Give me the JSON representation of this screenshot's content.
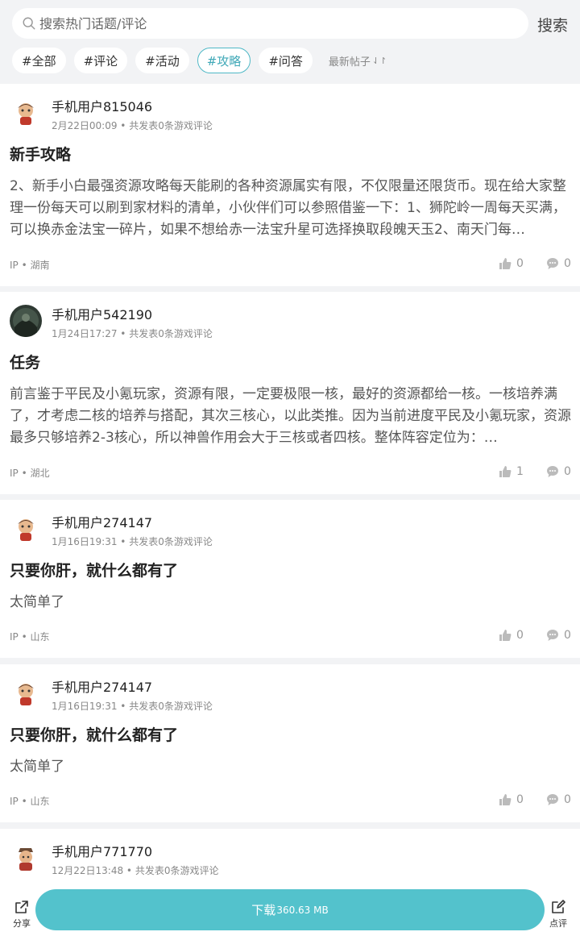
{
  "search": {
    "placeholder": "搜索热门话题/评论",
    "button": "搜索"
  },
  "tags": [
    "#全部",
    "#评论",
    "#活动",
    "#攻略",
    "#问答"
  ],
  "active_tag": "#攻略",
  "sort": {
    "label": "最新帖子",
    "icon": "sort-arrows-icon"
  },
  "posts": [
    {
      "user": "手机用户815046",
      "meta": "2月22日00:09 • 共发表0条游戏评论",
      "title": "新手攻略",
      "body": "2、新手小白最强资源攻略每天能刷的各种资源属实有限，不仅限量还限货币。现在给大家整理一份每天可以刷到家材料的清单，小伙伴们可以参照借鉴一下：1、狮陀岭一周每天买满，可以换赤金法宝一碎片，如果不想给赤一法宝升星可选择换取段魄天玉2、南天门每…",
      "ip": "IP • 湖南",
      "likes": "0",
      "comments": "0"
    },
    {
      "user": "手机用户542190",
      "meta": "1月24日17:27 • 共发表0条游戏评论",
      "title": "任务",
      "body": "前言鉴于平民及小氪玩家，资源有限，一定要极限一核，最好的资源都给一核。一核培养满了，才考虑二核的培养与搭配，其次三核心，以此类推。因为当前进度平民及小氪玩家，资源最多只够培养2-3核心，所以神兽作用会大于三核或者四核。整体阵容定位为：…",
      "ip": "IP • 湖北",
      "likes": "1",
      "comments": "0"
    },
    {
      "user": "手机用户274147",
      "meta": "1月16日19:31 • 共发表0条游戏评论",
      "title": "只要你肝，就什么都有了",
      "body": "太简单了",
      "ip": "IP • 山东",
      "likes": "0",
      "comments": "0"
    },
    {
      "user": "手机用户274147",
      "meta": "1月16日19:31 • 共发表0条游戏评论",
      "title": "只要你肝，就什么都有了",
      "body": "太简单了",
      "ip": "IP • 山东",
      "likes": "0",
      "comments": "0"
    },
    {
      "user": "手机用户771770",
      "meta": "12月22日13:48 • 共发表0条游戏评论"
    }
  ],
  "bottom": {
    "share": "分享",
    "download": "下载",
    "size": "360.63 MB",
    "review": "点评"
  },
  "colors": {
    "accent": "#53c2cc",
    "active_tag": "#3fa8b7",
    "page_bg": "#f2f3f5"
  }
}
